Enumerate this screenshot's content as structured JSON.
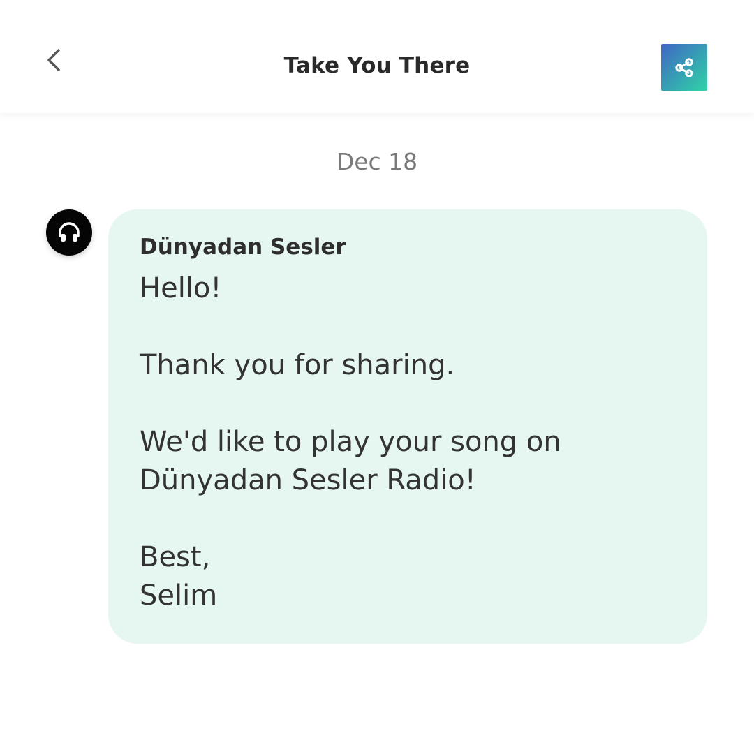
{
  "header": {
    "title": "Take You There",
    "back_icon": "chevron-left-icon",
    "share_icon": "share-icon",
    "share_gradient": [
      "#3f66c4",
      "#2fd4a6"
    ]
  },
  "conversation": {
    "date": "Dec 18",
    "message": {
      "avatar_icon": "headphones-icon",
      "sender": "Dünyadan Sesler",
      "lines": [
        "Hello!",
        "",
        "Thank you for sharing.",
        "",
        "We'd like to play your song on",
        "Dünyadan Sesler Radio!",
        "",
        "Best,",
        "Selim"
      ]
    }
  },
  "colors": {
    "bubble_bg": "#e6f6f0",
    "avatar_bg": "#050505",
    "date_text": "#7a7a7a"
  }
}
